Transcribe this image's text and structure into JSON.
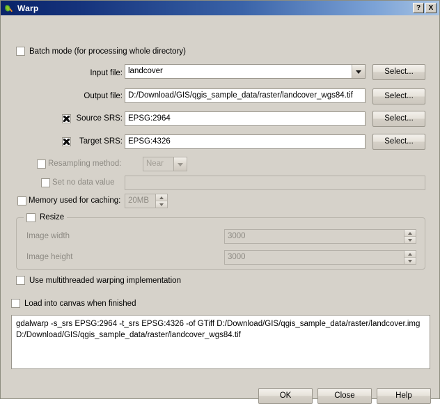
{
  "window": {
    "title": "Warp",
    "logo_icon": "qgis-q-logo",
    "help_button": "?",
    "close_button": "X"
  },
  "form": {
    "batch_mode": {
      "label": "Batch mode (for processing whole directory)",
      "checked": false
    },
    "input_file": {
      "label": "Input file:",
      "value": "landcover",
      "select_label": "Select..."
    },
    "output_file": {
      "label": "Output file:",
      "value": "D:/Download/GIS/qgis_sample_data/raster/landcover_wgs84.tif",
      "select_label": "Select..."
    },
    "source_srs": {
      "label": "Source SRS:",
      "value": "EPSG:2964",
      "checked": true,
      "select_label": "Select..."
    },
    "target_srs": {
      "label": "Target SRS:",
      "value": "EPSG:4326",
      "checked": true,
      "select_label": "Select..."
    },
    "resampling": {
      "label": "Resampling method:",
      "value": "Near",
      "checked": false,
      "enabled": false
    },
    "no_data": {
      "label": "Set no data value",
      "value": "",
      "checked": false,
      "enabled": false
    },
    "memory": {
      "label": "Memory used for caching:",
      "value": "20MB",
      "checked": false,
      "enabled": false
    },
    "resize": {
      "label": "Resize",
      "checked": false,
      "image_width": {
        "label": "Image width",
        "value": "3000"
      },
      "image_height": {
        "label": "Image height",
        "value": "3000"
      }
    },
    "multithreaded": {
      "label": "Use multithreaded warping implementation",
      "checked": false
    },
    "load_canvas": {
      "label": "Load into canvas when finished",
      "checked": false
    }
  },
  "command": {
    "text": "gdalwarp -s_srs EPSG:2964 -t_srs EPSG:4326 -of GTiff D:/Download/GIS/qgis_sample_data/raster/landcover.img D:/Download/GIS/qgis_sample_data/raster/landcover_wgs84.tif"
  },
  "buttons": {
    "ok": "OK",
    "close": "Close",
    "help": "Help"
  },
  "colors": {
    "dialog_bg": "#d6d2ca",
    "titlebar_start": "#0a246a",
    "titlebar_end": "#a8c4e4",
    "field_bg": "#ffffff",
    "disabled_text": "#8d8a83"
  }
}
